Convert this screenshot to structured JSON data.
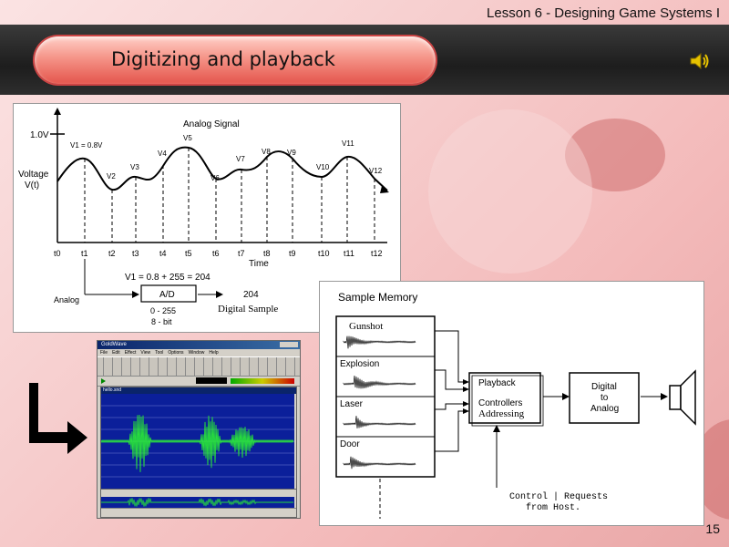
{
  "header": {
    "lesson": "Lesson 6 - Designing Game Systems I",
    "title": "Digitizing and playback",
    "page": "15",
    "speaker_icon": "speaker-icon"
  },
  "analog": {
    "title": "Analog Signal",
    "ymax_label": "1.0V",
    "ylabel_line1": "Voltage",
    "ylabel_line2": "V(t)",
    "xlabel": "Time",
    "v_labels": [
      "V1 = 0.8V",
      "V2",
      "V3",
      "V4",
      "V5",
      "V6",
      "V7",
      "V8",
      "V9",
      "V10",
      "V11",
      "V12"
    ],
    "t_labels": [
      "t0",
      "t1",
      "t2",
      "t3",
      "t4",
      "t5",
      "t6",
      "t7",
      "t8",
      "t9",
      "t10",
      "t11",
      "t12"
    ],
    "formula": "V1 = 0.8 + 255 = 204",
    "analog_label": "Analog",
    "ad_label": "A/D",
    "range_label": "0 - 255",
    "bits_label": "8 - bit",
    "out_value": "204",
    "out_label": "Digital Sample"
  },
  "memory": {
    "title": "Sample Memory",
    "samples": [
      "Gunshot",
      "Explosion",
      "Laser",
      "Door"
    ],
    "playback_line1": "Playback",
    "playback_line2": "Controllers",
    "playback_line3": "Addressing",
    "dac_line1": "Digital",
    "dac_line2": "to",
    "dac_line3": "Analog",
    "control_line1": "Control | Requests",
    "control_line2": "from Host."
  },
  "editor": {
    "app_title": "GoldWave",
    "menu": [
      "File",
      "Edit",
      "Effect",
      "View",
      "Tool",
      "Options",
      "Window",
      "Help"
    ],
    "file_title": "hello.snd"
  }
}
